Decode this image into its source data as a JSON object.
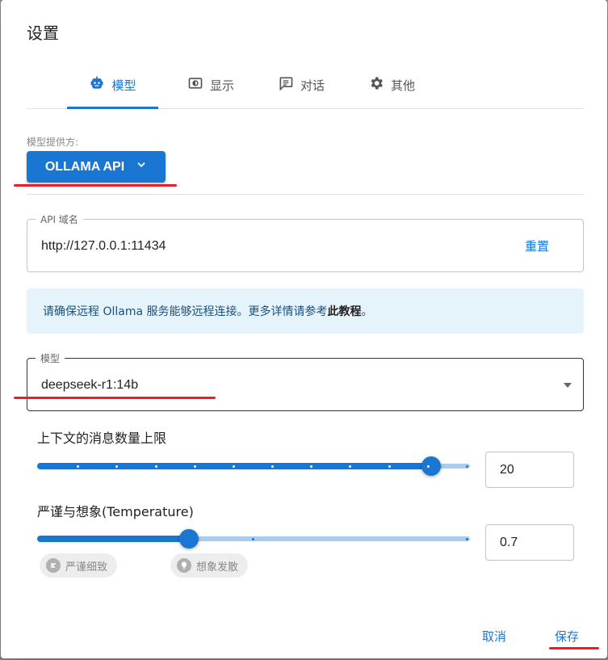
{
  "dialog": {
    "title": "设置"
  },
  "tabs": [
    {
      "label": "模型",
      "icon": "robot-icon",
      "active": true
    },
    {
      "label": "显示",
      "icon": "display-icon",
      "active": false
    },
    {
      "label": "对话",
      "icon": "chat-icon",
      "active": false
    },
    {
      "label": "其他",
      "icon": "gear-icon",
      "active": false
    }
  ],
  "provider": {
    "label": "模型提供方:",
    "value": "OLLAMA API"
  },
  "api": {
    "legend": "API 域名",
    "value": "http://127.0.0.1:11434",
    "reset_label": "重置"
  },
  "info": {
    "text": "请确保远程 Ollama 服务能够远程连接。更多详情请参考",
    "link": "此教程",
    "suffix": "。"
  },
  "model": {
    "legend": "模型",
    "value": "deepseek-r1:14b"
  },
  "context_slider": {
    "label": "上下文的消息数量上限",
    "value": "20",
    "fraction": 0.91
  },
  "temperature_slider": {
    "label": "严谨与想象(Temperature)",
    "value": "0.7",
    "fraction": 0.35
  },
  "chips": {
    "precise": "严谨细致",
    "creative": "想象发散"
  },
  "footer": {
    "cancel": "取消",
    "save": "保存"
  },
  "colors": {
    "primary": "#1976d2",
    "annotation": "#e5202a",
    "info_bg": "#e5f4fb"
  }
}
